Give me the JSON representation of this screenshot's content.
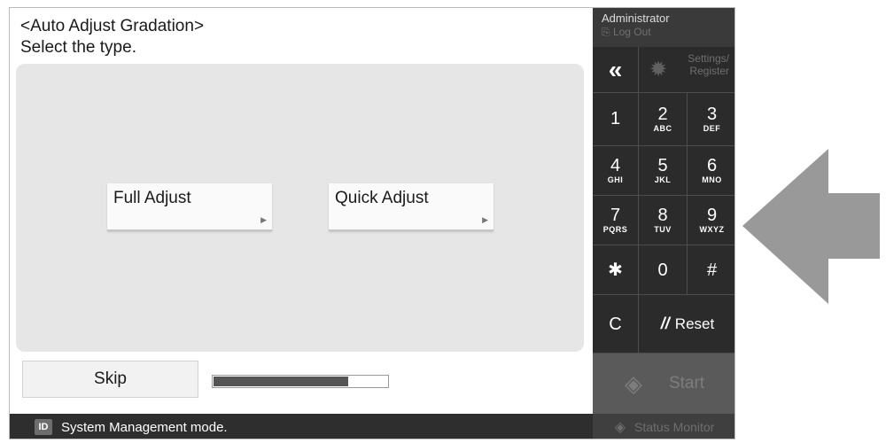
{
  "header": {
    "title": "<Auto Adjust Gradation>",
    "subtitle": "Select the type."
  },
  "options": [
    {
      "label": "Full Adjust"
    },
    {
      "label": "Quick Adjust"
    }
  ],
  "skip_label": "Skip",
  "progress": {
    "value": 0.77
  },
  "statusbar": {
    "badge": "ID",
    "text": "System Management mode."
  },
  "side": {
    "user": "Administrator",
    "logout": "Log Out",
    "back_icon": "«",
    "settings_line1": "Settings/",
    "settings_line2": "Register",
    "keys": [
      {
        "num": "1",
        "sub": ""
      },
      {
        "num": "2",
        "sub": "ABC"
      },
      {
        "num": "3",
        "sub": "DEF"
      },
      {
        "num": "4",
        "sub": "GHI"
      },
      {
        "num": "5",
        "sub": "JKL"
      },
      {
        "num": "6",
        "sub": "MNO"
      },
      {
        "num": "7",
        "sub": "PQRS"
      },
      {
        "num": "8",
        "sub": "TUV"
      },
      {
        "num": "9",
        "sub": "WXYZ"
      },
      {
        "num": "✱",
        "sub": ""
      },
      {
        "num": "0",
        "sub": ""
      },
      {
        "num": "#",
        "sub": ""
      }
    ],
    "clear_label": "C",
    "reset_label": "Reset",
    "start_label": "Start",
    "status_monitor_label": "Status Monitor"
  },
  "colors": {
    "panel": "#e6e6e6",
    "side": "#2b2b2b",
    "arrow": "#999999"
  }
}
